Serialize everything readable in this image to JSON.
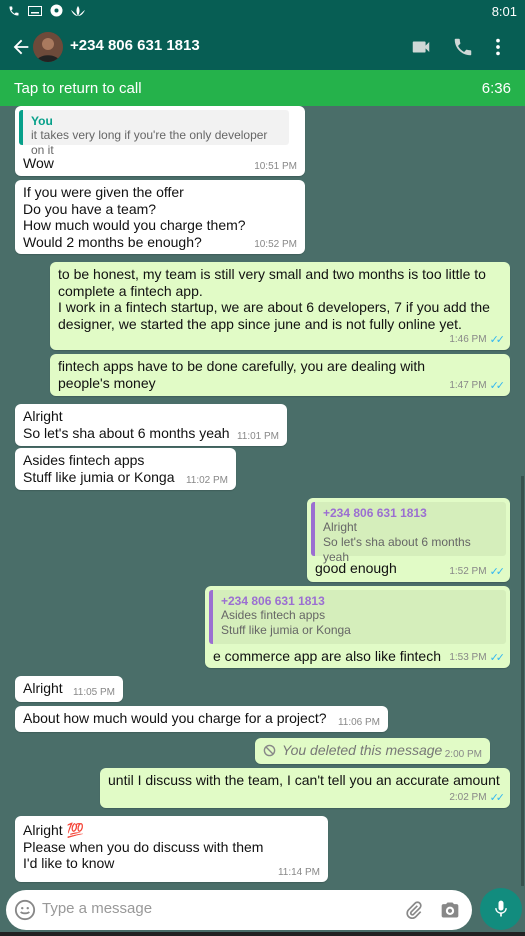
{
  "status": {
    "time": "8:01"
  },
  "header": {
    "contact": "+234 806 631 1813",
    "icons": [
      "video-icon",
      "phone-icon",
      "more-icon"
    ]
  },
  "call": {
    "label": "Tap to return to call",
    "duration": "6:36"
  },
  "messages": [
    {
      "dir": "in",
      "quote_name": "You",
      "quote_text": "it takes very long if you're the only developer on it",
      "text": "Wow",
      "time": "10:51 PM"
    },
    {
      "dir": "in",
      "text": "If you were given the offer\nDo you have a team?\nHow much would you charge them?\nWould 2 months be enough?",
      "time": "10:52 PM"
    },
    {
      "dir": "out",
      "text": "to be honest, my team is still very small and two months is too little to complete a fintech app.\nI work in a fintech startup, we are about 6 developers,  7 if you add the designer, we started the app since june and is not fully online yet.",
      "time": "1:46 PM"
    },
    {
      "dir": "out",
      "text": "fintech apps have to be done carefully, you are dealing with people's money",
      "time": "1:47 PM"
    },
    {
      "dir": "in",
      "text": "Alright\nSo let's sha about 6 months yeah",
      "time": "11:01 PM"
    },
    {
      "dir": "in",
      "text": "Asides fintech apps\nStuff like jumia or Konga",
      "time": "11:02 PM"
    },
    {
      "dir": "out",
      "quote_name": "+234 806 631 1813",
      "quote_text": "Alright\nSo let's sha about 6 months yeah",
      "text": "good enough",
      "time": "1:52 PM"
    },
    {
      "dir": "out",
      "quote_name": "+234 806 631 1813",
      "quote_text": "Asides fintech apps\nStuff like jumia or Konga",
      "text": "e commerce app are also like fintech",
      "time": "1:53 PM"
    },
    {
      "dir": "in",
      "text": "Alright",
      "time": "11:05 PM"
    },
    {
      "dir": "in",
      "text": "About how much would you charge for a project?",
      "time": "11:06 PM"
    },
    {
      "dir": "out",
      "text": "You deleted this message",
      "time": "2:00 PM"
    },
    {
      "dir": "out",
      "text": "until I discuss with the team, I can't tell you an accurate amount",
      "time": "2:02 PM"
    },
    {
      "dir": "in",
      "text": "Alright 💯\nPlease when you do discuss with them\nI'd like to know",
      "time": "11:14 PM"
    }
  ],
  "composer": {
    "placeholder": "Type a message"
  },
  "colors": {
    "header": "#075e54",
    "call_bar": "#25b24b",
    "incoming": "#ffffff",
    "outgoing": "#e1fbc6",
    "chat_bg": "#4a6e69",
    "read_ticks": "#34b7f1"
  }
}
